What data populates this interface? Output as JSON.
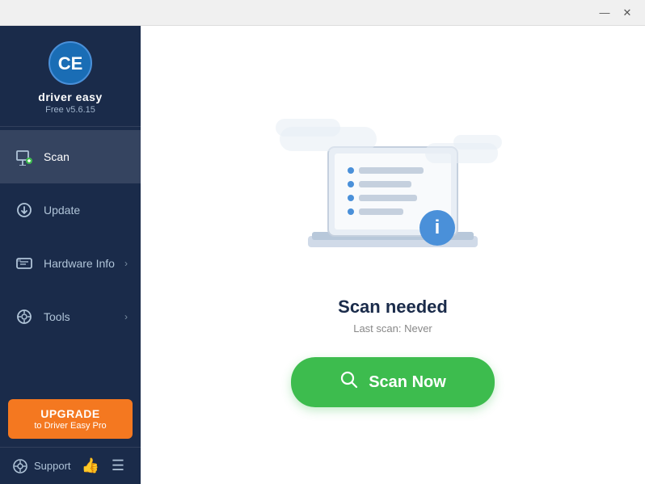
{
  "titleBar": {
    "minimizeLabel": "—",
    "closeLabel": "✕"
  },
  "sidebar": {
    "logo": {
      "appName": "driver easy",
      "version": "Free v5.6.15"
    },
    "navItems": [
      {
        "id": "scan",
        "label": "Scan",
        "active": true,
        "hasArrow": false
      },
      {
        "id": "update",
        "label": "Update",
        "active": false,
        "hasArrow": false
      },
      {
        "id": "hardware-info",
        "label": "Hardware Info",
        "active": false,
        "hasArrow": true
      },
      {
        "id": "tools",
        "label": "Tools",
        "active": false,
        "hasArrow": true
      }
    ],
    "upgradeBtn": {
      "line1": "UPGRADE",
      "line2": "to Driver Easy Pro"
    },
    "support": {
      "label": "Support"
    }
  },
  "content": {
    "statusTitle": "Scan needed",
    "statusSub": "Last scan: Never",
    "scanBtnLabel": "Scan Now"
  }
}
